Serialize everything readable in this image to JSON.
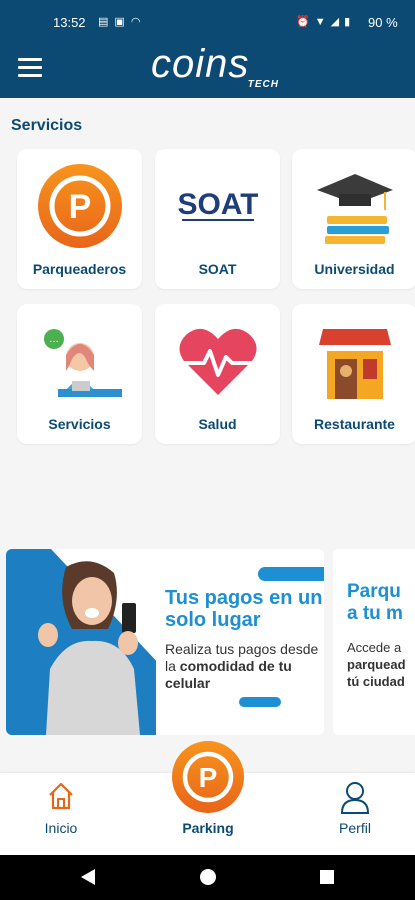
{
  "status_bar": {
    "time": "13:52",
    "battery": "90 %",
    "left_icons": [
      "note-icon",
      "image-icon",
      "headset-icon"
    ],
    "right_icons": [
      "alarm-icon",
      "wifi-icon",
      "signal-icon",
      "battery-icon"
    ]
  },
  "header": {
    "logo_main": "coins",
    "logo_sub": "TECH",
    "brand_color": "#0c4a73"
  },
  "section": {
    "title": "Servicios"
  },
  "services": [
    {
      "label": "Parqueaderos",
      "icon": "parking-icon"
    },
    {
      "label": "SOAT",
      "icon": "soat-logo"
    },
    {
      "label": "Universidad",
      "icon": "graduation-books-icon"
    },
    {
      "label": "Servicios",
      "icon": "support-agent-icon"
    },
    {
      "label": "Salud",
      "icon": "heart-pulse-icon"
    },
    {
      "label": "Restaurante",
      "icon": "restaurant-store-icon"
    }
  ],
  "soat_logo_text": "SOAT",
  "banners": [
    {
      "title": "Tus pagos en un solo lugar",
      "text_a": "Realiza tus pagos desde la ",
      "text_bold": "comodidad de tu celular"
    },
    {
      "title_line1": "Parqu",
      "title_line2": "a tu m",
      "text_line1": "Accede a",
      "text_line2": "parquead",
      "text_line3": "tú ciudad"
    }
  ],
  "bottom_nav": {
    "inicio": "Inicio",
    "parking": "Parking",
    "perfil": "Perfil"
  },
  "colors": {
    "accent": "#f07c1b",
    "banner_blue": "#1d8fd3"
  }
}
